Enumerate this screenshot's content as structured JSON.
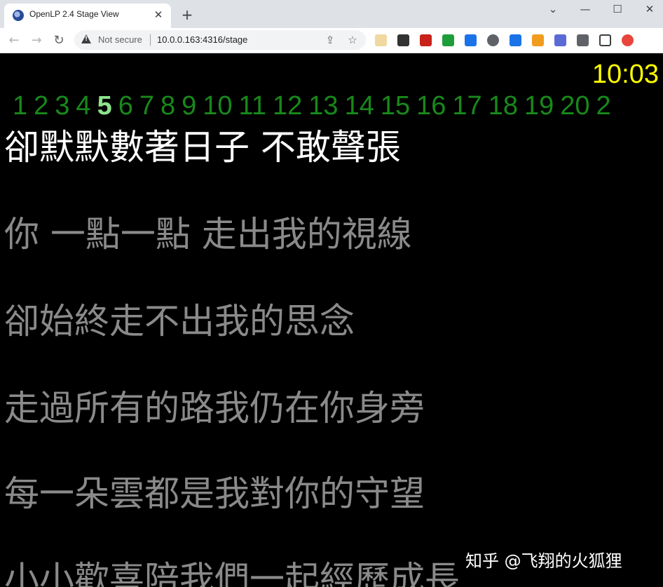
{
  "browser": {
    "tab_title": "OpenLP 2.4 Stage View",
    "tab_close": "✕",
    "new_tab": "+",
    "window_controls": [
      "⌄",
      "—",
      "☐",
      "✕"
    ],
    "security_label": "Not secure",
    "url": "10.0.0.163:4316/stage",
    "extension_colors": [
      "#f0d9a0",
      "#333333",
      "#c8221b",
      "#1e9e3a",
      "#1a73e8",
      "#5f6368",
      "#1a73e8",
      "#f29c1f",
      "#5b6bd6",
      "#5f6368",
      "#3c4043",
      "#e8453c"
    ]
  },
  "stage": {
    "clock": "10:03",
    "current_slide": "5",
    "slide_numbers": [
      "1",
      "2",
      "3",
      "4",
      "5",
      "6",
      "7",
      "8",
      "9",
      "10",
      "11",
      "12",
      "13",
      "14",
      "15",
      "16",
      "17",
      "18",
      "19",
      "20",
      "2"
    ],
    "lyrics": [
      "卻默默數著日子 不敢聲張",
      "你 一點一點 走出我的視線",
      "卻始終走不出我的思念",
      "走過所有的路我仍在你身旁",
      "每一朵雲都是我對你的守望",
      "小小歡喜陪我們一起經歷成長"
    ],
    "colors": {
      "background": "#000000",
      "clock": "#ffff00",
      "slide_number": "#18891a",
      "slide_number_current": "#8ce48c",
      "current_text": "#ffffff",
      "next_text": "#8a8a8a"
    }
  },
  "watermark": "知乎 @飞翔的火狐狸"
}
